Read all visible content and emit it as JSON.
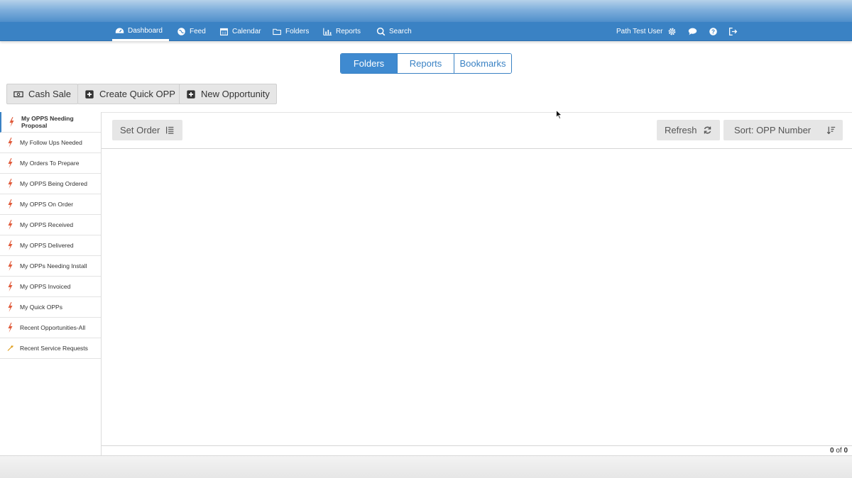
{
  "nav": {
    "items": [
      {
        "label": "Dashboard",
        "icon": "tachometer-icon"
      },
      {
        "label": "Feed",
        "icon": "globe-icon"
      },
      {
        "label": "Calendar",
        "icon": "calendar-icon"
      },
      {
        "label": "Folders",
        "icon": "folder-open-icon"
      },
      {
        "label": "Reports",
        "icon": "bar-chart-icon"
      },
      {
        "label": "Search",
        "icon": "search-icon"
      }
    ],
    "user_name": "Path Test User",
    "icons": [
      "gear-icon",
      "chat-icon",
      "help-icon",
      "sign-out-icon"
    ],
    "accent": "#3a82c4"
  },
  "segments": {
    "items": [
      "Folders",
      "Reports",
      "Bookmarks"
    ],
    "selected": "Folders"
  },
  "actions": {
    "cash_sale": "Cash Sale",
    "create_quick_opp": "Create Quick OPP",
    "new_opportunity": "New Opportunity"
  },
  "sidebar": {
    "items": [
      {
        "label": "My OPPS Needing Proposal",
        "icon": "lightning-icon"
      },
      {
        "label": "My Follow Ups Needed",
        "icon": "lightning-icon"
      },
      {
        "label": "My Orders To Prepare",
        "icon": "lightning-icon"
      },
      {
        "label": "My OPPS Being Ordered",
        "icon": "lightning-icon"
      },
      {
        "label": "My OPPS On Order",
        "icon": "lightning-icon"
      },
      {
        "label": "My OPPS Received",
        "icon": "lightning-icon"
      },
      {
        "label": "My OPPS Delivered",
        "icon": "lightning-icon"
      },
      {
        "label": "My OPPs Needing Install",
        "icon": "lightning-icon"
      },
      {
        "label": "My OPPS Invoiced",
        "icon": "lightning-icon"
      },
      {
        "label": "My Quick OPPs",
        "icon": "lightning-icon"
      },
      {
        "label": "Recent Opportunities-All",
        "icon": "lightning-icon"
      },
      {
        "label": "Recent Service Requests",
        "icon": "wrench-icon"
      }
    ],
    "selected": "My OPPS Needing Proposal"
  },
  "toolbar": {
    "set_order": "Set Order",
    "refresh": "Refresh",
    "sort": "Sort: OPP Number"
  },
  "pager": {
    "from": "0",
    "of_label": "of",
    "to": "0"
  }
}
